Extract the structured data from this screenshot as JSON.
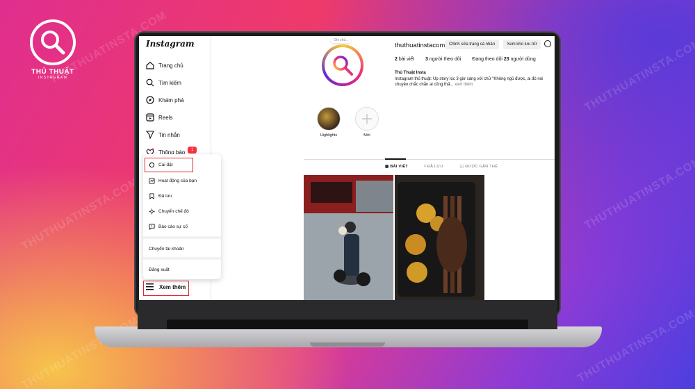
{
  "brand": {
    "line1": "THỦ THUẬT",
    "line2": "INSTAGRAM"
  },
  "watermark": "THUTHUATINSTA.COM",
  "sidebar": {
    "logo": "Instagram",
    "items": [
      {
        "label": "Trang chủ",
        "icon": "home-icon"
      },
      {
        "label": "Tìm kiếm",
        "icon": "search-icon"
      },
      {
        "label": "Khám phá",
        "icon": "compass-icon"
      },
      {
        "label": "Reels",
        "icon": "reels-icon"
      },
      {
        "label": "Tin nhắn",
        "icon": "send-icon"
      },
      {
        "label": "Thông báo",
        "icon": "heart-icon"
      }
    ],
    "notif_badge": "1",
    "more_label": "Xem thêm"
  },
  "menu": {
    "items": [
      {
        "label": "Cài đặt",
        "icon": "settings-icon"
      },
      {
        "label": "Hoạt động của bạn",
        "icon": "activity-icon"
      },
      {
        "label": "Đã lưu",
        "icon": "bookmark-icon"
      },
      {
        "label": "Chuyển chế độ",
        "icon": "sun-icon"
      },
      {
        "label": "Báo cáo sự cố",
        "icon": "report-icon"
      }
    ],
    "switch_account": "Chuyển tài khoản",
    "logout": "Đăng xuất"
  },
  "profile": {
    "note": "Ghi chú...",
    "username": "thuthuatinstacom",
    "edit_button": "Chỉnh sửa trang cá nhân",
    "archive_button": "Xem kho lưu trữ",
    "stats": {
      "posts_count": "2",
      "posts_label": "bài viết",
      "followers_count": "3",
      "followers_label": "người theo dõi",
      "following_prefix": "Đang theo dõi",
      "following_count": "23",
      "following_label": "người dùng"
    },
    "display_name": "Thủ Thuật Insta",
    "bio": "Instagram thủ thuật: Up story lúc 3 giờ sáng với chữ \"Không ngủ được, ai đó nói chuyện chắc chắn ai cũng thấ...",
    "bio_more": "xem thêm",
    "highlights": [
      {
        "label": "Highlights"
      },
      {
        "label": "Mới"
      }
    ]
  },
  "tabs": [
    {
      "label": "BÀI VIẾT",
      "active": true
    },
    {
      "label": "ĐÃ LƯU",
      "active": false
    },
    {
      "label": "ĐƯỢC GẮN THẺ",
      "active": false
    }
  ],
  "colors": {
    "accent_red": "#e0262f",
    "badge": "#ff3040"
  }
}
